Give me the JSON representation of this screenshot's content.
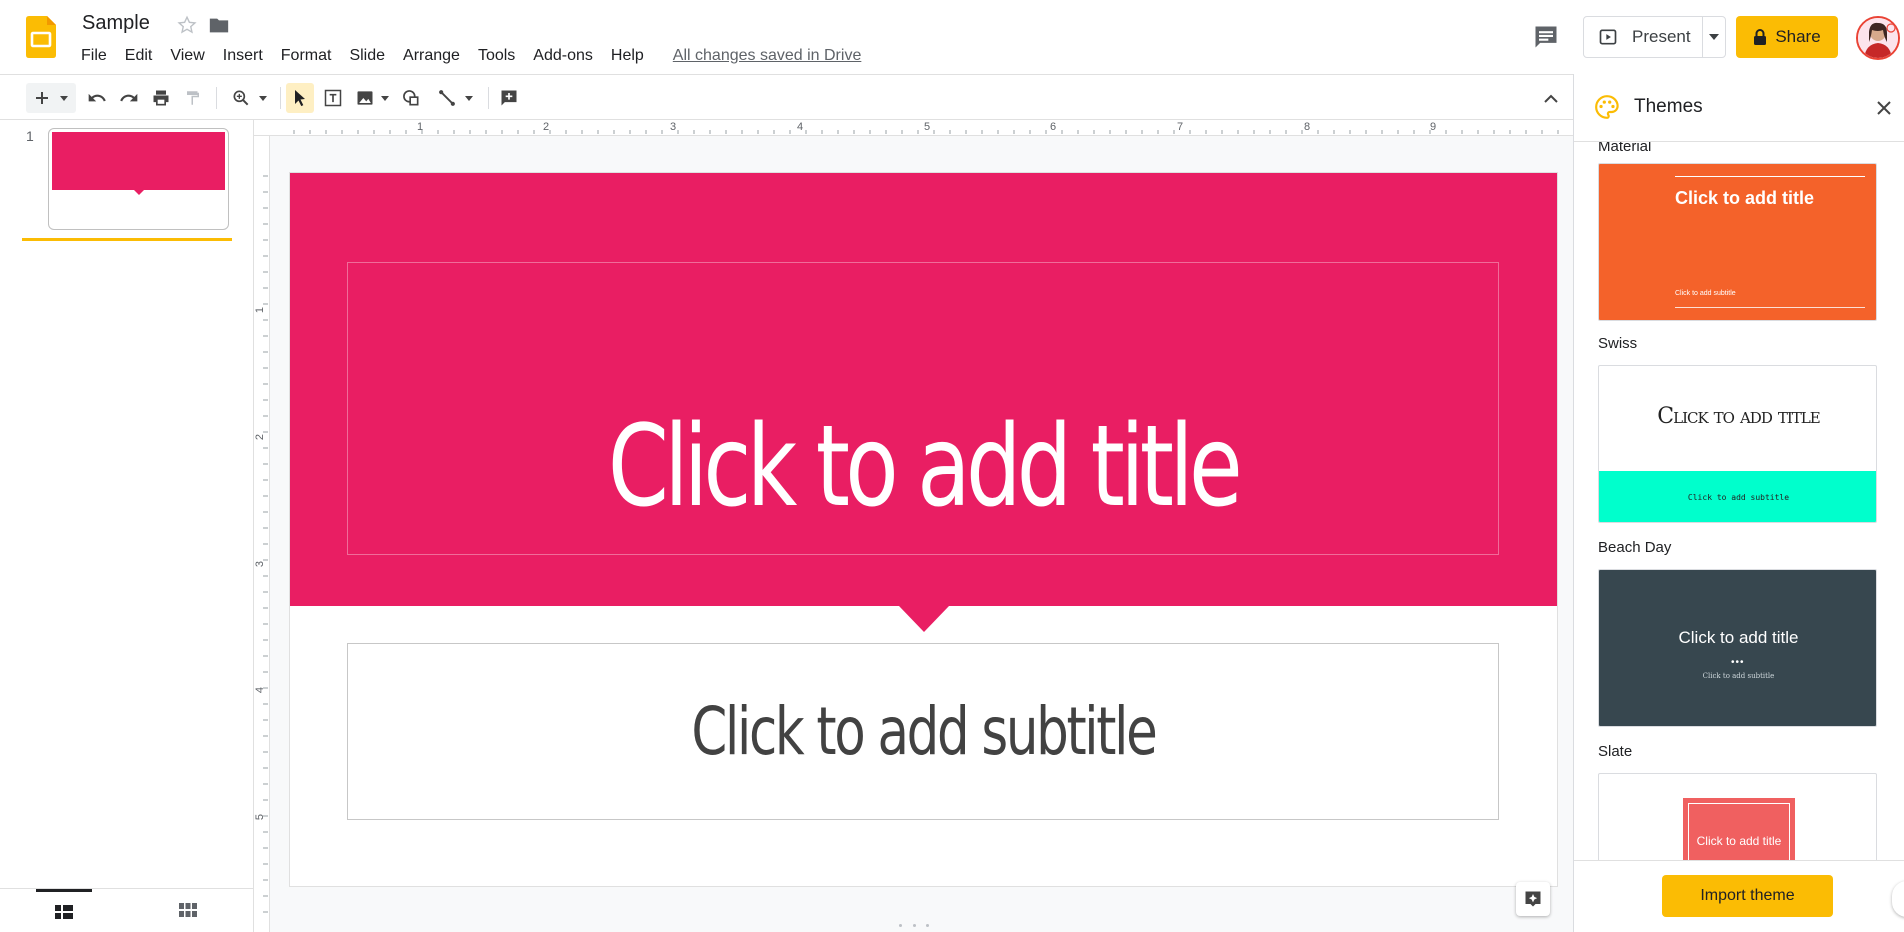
{
  "header": {
    "doc_title": "Sample",
    "menu": [
      "File",
      "Edit",
      "View",
      "Insert",
      "Format",
      "Slide",
      "Arrange",
      "Tools",
      "Add-ons",
      "Help"
    ],
    "save_status": "All changes saved in Drive",
    "present_label": "Present",
    "share_label": "Share"
  },
  "filmstrip": {
    "slide_number": "1"
  },
  "ruler": {
    "top_numbers": [
      "1",
      "2",
      "3",
      "4",
      "5",
      "6",
      "7",
      "8",
      "9"
    ],
    "left_numbers": [
      "1",
      "2",
      "3",
      "4",
      "5"
    ]
  },
  "slide": {
    "title_placeholder": "Click to add title",
    "subtitle_placeholder": "Click to add subtitle",
    "colors": {
      "band": "#e91e63",
      "title": "#ffffff",
      "subtitle": "#424242"
    }
  },
  "themes_panel": {
    "title": "Themes",
    "themes": [
      {
        "name": "Material",
        "title_text": "Click to add title",
        "subtitle_text": "Click to add subtitle",
        "bg": "#f4622a"
      },
      {
        "name": "Swiss",
        "title_text": "Click to add title",
        "subtitle_text": "Click to add subtitle",
        "accent": "#00ffcc"
      },
      {
        "name": "Beach Day",
        "title_text": "Click to add title",
        "subtitle_text": "Click to add subtitle",
        "bg": "#37474f"
      },
      {
        "name": "Slate",
        "title_text": "Click to add title",
        "bg": "#f06060"
      }
    ],
    "import_label": "Import theme"
  },
  "colors": {
    "accent_yellow": "#fbbc04",
    "icon_gray": "#5f6368"
  }
}
